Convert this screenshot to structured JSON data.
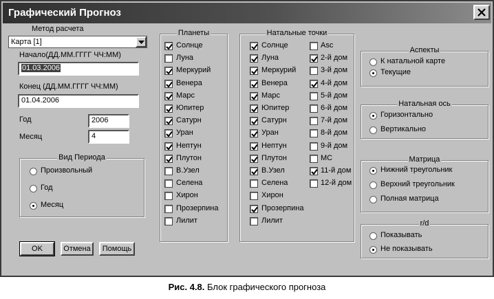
{
  "window": {
    "title": "Графический Прогноз"
  },
  "method": {
    "label": "Метод расчета",
    "value": "Карта [1]"
  },
  "start": {
    "label": "Начало(ДД.ММ.ГГГГ ЧЧ:ММ)",
    "value": "01.03.2006"
  },
  "end": {
    "label": "Конец (ДД.ММ.ГГГГ ЧЧ:ММ)",
    "value": "01.04.2006"
  },
  "year": {
    "label": "Год",
    "value": "2006"
  },
  "month": {
    "label": "Месяц",
    "value": "4"
  },
  "period": {
    "title": "Вид Периода",
    "options": [
      {
        "label": "Произвольный",
        "selected": false
      },
      {
        "label": "Год",
        "selected": false
      },
      {
        "label": "Месяц",
        "selected": true
      }
    ]
  },
  "buttons": {
    "ok": "OK",
    "cancel": "Отмена",
    "help": "Помощь"
  },
  "planets": {
    "title": "Планеты",
    "items": [
      {
        "label": "Солнце",
        "checked": true
      },
      {
        "label": "Луна",
        "checked": false
      },
      {
        "label": "Меркурий",
        "checked": true
      },
      {
        "label": "Венера",
        "checked": true
      },
      {
        "label": "Марс",
        "checked": true
      },
      {
        "label": "Юпитер",
        "checked": true
      },
      {
        "label": "Сатурн",
        "checked": true
      },
      {
        "label": "Уран",
        "checked": true
      },
      {
        "label": "Нептун",
        "checked": true
      },
      {
        "label": "Плутон",
        "checked": true
      },
      {
        "label": "В.Узел",
        "checked": false
      },
      {
        "label": "Селена",
        "checked": false
      },
      {
        "label": "Хирон",
        "checked": false
      },
      {
        "label": "Прозерпина",
        "checked": false
      },
      {
        "label": "Лилит",
        "checked": false
      }
    ]
  },
  "natal": {
    "title": "Натальные точки",
    "left": [
      {
        "label": "Солнце",
        "checked": true
      },
      {
        "label": "Луна",
        "checked": true
      },
      {
        "label": "Меркурий",
        "checked": true
      },
      {
        "label": "Венера",
        "checked": true
      },
      {
        "label": "Марс",
        "checked": true
      },
      {
        "label": "Юпитер",
        "checked": true
      },
      {
        "label": "Сатурн",
        "checked": true
      },
      {
        "label": "Уран",
        "checked": true
      },
      {
        "label": "Нептун",
        "checked": true
      },
      {
        "label": "Плутон",
        "checked": true
      },
      {
        "label": "В.Узел",
        "checked": true
      },
      {
        "label": "Селена",
        "checked": false
      },
      {
        "label": "Хирон",
        "checked": false
      },
      {
        "label": "Прозерпина",
        "checked": true
      },
      {
        "label": "Лилит",
        "checked": false
      }
    ],
    "right": [
      {
        "label": "Asc",
        "checked": false
      },
      {
        "label": "2-й дом",
        "checked": true
      },
      {
        "label": "3-й дом",
        "checked": false
      },
      {
        "label": "4-й дом",
        "checked": true
      },
      {
        "label": "5-й дом",
        "checked": false
      },
      {
        "label": "6-й дом",
        "checked": false
      },
      {
        "label": "7-й дом",
        "checked": false
      },
      {
        "label": "8-й дом",
        "checked": false
      },
      {
        "label": "9-й дом",
        "checked": false
      },
      {
        "label": "MC",
        "checked": false
      },
      {
        "label": "11-й дом",
        "checked": true
      },
      {
        "label": "12-й дом",
        "checked": false
      }
    ]
  },
  "aspects": {
    "title": "Аспекты",
    "options": [
      {
        "label": "К натальной карте",
        "selected": false
      },
      {
        "label": "Текущие",
        "selected": true
      }
    ]
  },
  "axis": {
    "title": "Натальная ось",
    "options": [
      {
        "label": "Горизонтально",
        "selected": true
      },
      {
        "label": "Вертикально",
        "selected": false
      }
    ]
  },
  "matrix": {
    "title": "Матрица",
    "options": [
      {
        "label": "Нижний треугольник",
        "selected": true
      },
      {
        "label": "Верхний треугольник",
        "selected": false
      },
      {
        "label": "Полная матрица",
        "selected": false
      }
    ]
  },
  "rd": {
    "title": "r/d",
    "options": [
      {
        "label": "Показывать",
        "selected": false
      },
      {
        "label": "Не показывать",
        "selected": true
      }
    ]
  },
  "caption": {
    "prefix": "Рис. 4.8.",
    "text": " Блок графического прогноза"
  }
}
